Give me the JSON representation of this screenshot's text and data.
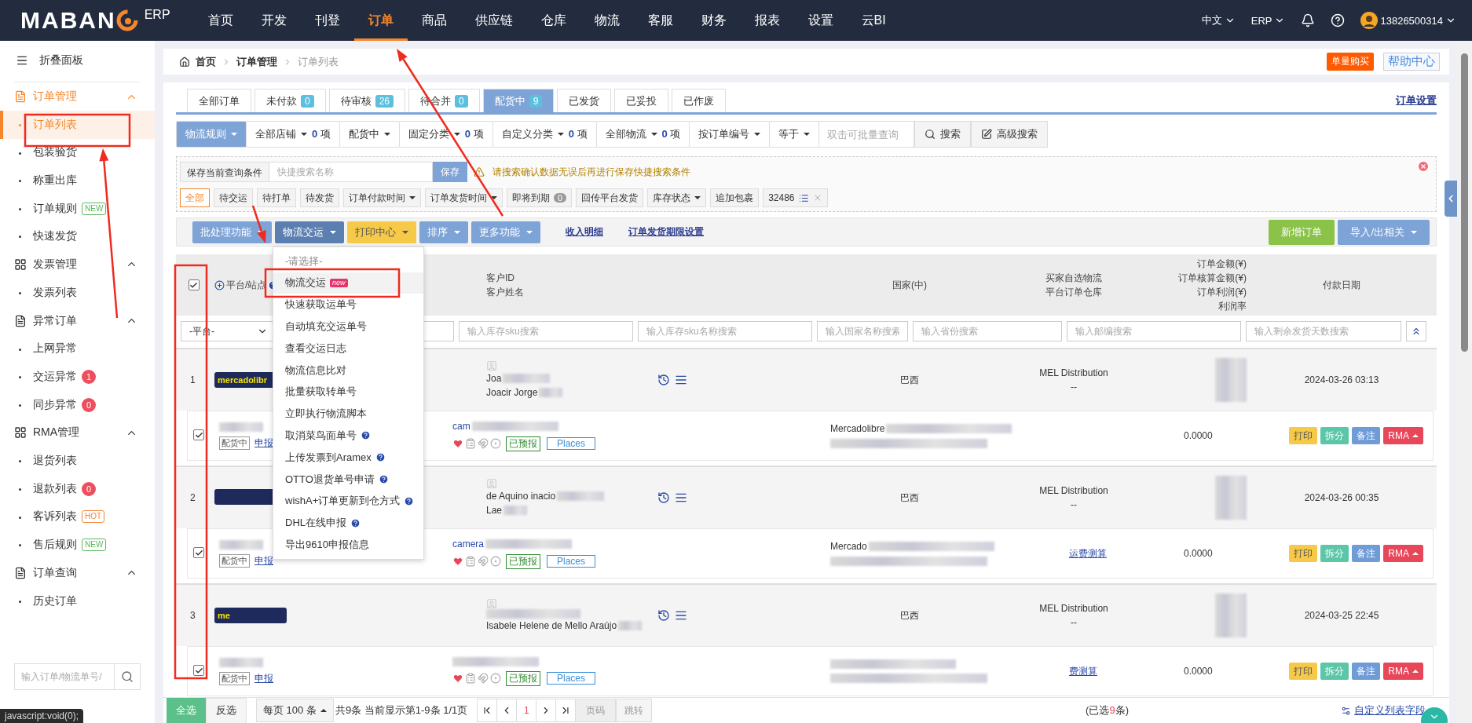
{
  "topbar": {
    "logo": "MABAN",
    "logo_suffix": "ERP",
    "nav": [
      {
        "label": "首页",
        "selected": false
      },
      {
        "label": "开发",
        "selected": false
      },
      {
        "label": "刊登",
        "selected": false
      },
      {
        "label": "订单",
        "selected": true
      },
      {
        "label": "商品",
        "selected": false
      },
      {
        "label": "供应链",
        "selected": false
      },
      {
        "label": "仓库",
        "selected": false
      },
      {
        "label": "物流",
        "selected": false
      },
      {
        "label": "客服",
        "selected": false
      },
      {
        "label": "财务",
        "selected": false
      },
      {
        "label": "报表",
        "selected": false
      },
      {
        "label": "设置",
        "selected": false
      },
      {
        "label": "云BI",
        "selected": false
      }
    ],
    "language": "中文",
    "system": "ERP",
    "user": "13826500314"
  },
  "sidebar": {
    "collapse": "折叠面板",
    "groups": [
      {
        "title": "订单管理",
        "kind": "doc",
        "active": true,
        "expanded": true,
        "items": [
          {
            "label": "订单列表",
            "selected": true
          },
          {
            "label": "包装验货",
            "selected": false
          },
          {
            "label": "称重出库",
            "selected": false
          },
          {
            "label": "订单规则",
            "selected": false,
            "badge": {
              "kind": "new",
              "text": "NEW"
            }
          },
          {
            "label": "快速发货",
            "selected": false
          }
        ]
      },
      {
        "title": "发票管理",
        "kind": "grid",
        "active": false,
        "expanded": true,
        "items": [
          {
            "label": "发票列表",
            "selected": false
          }
        ]
      },
      {
        "title": "异常订单",
        "kind": "doc",
        "active": false,
        "expanded": true,
        "items": [
          {
            "label": "上网异常",
            "selected": false
          },
          {
            "label": "交运异常",
            "selected": false,
            "badge": {
              "kind": "count",
              "text": "1"
            }
          },
          {
            "label": "同步异常",
            "selected": false,
            "badge": {
              "kind": "count",
              "text": "0"
            }
          }
        ]
      },
      {
        "title": "RMA管理",
        "kind": "grid",
        "active": false,
        "expanded": true,
        "items": [
          {
            "label": "退货列表",
            "selected": false
          },
          {
            "label": "退款列表",
            "selected": false,
            "badge": {
              "kind": "count",
              "text": "0"
            }
          },
          {
            "label": "客诉列表",
            "selected": false,
            "badge": {
              "kind": "hot",
              "text": "HOT"
            }
          },
          {
            "label": "售后规则",
            "selected": false,
            "badge": {
              "kind": "new",
              "text": "NEW"
            }
          }
        ]
      },
      {
        "title": "订单查询",
        "kind": "doc",
        "active": false,
        "expanded": true,
        "items": [
          {
            "label": "历史订单",
            "selected": false
          }
        ]
      }
    ],
    "search": {
      "placeholder": "输入订单/物流单号/"
    }
  },
  "breadcrumb": [
    "首页",
    "订单管理",
    "订单列表"
  ],
  "header_buttons": {
    "buy": "单量购买",
    "help": "帮助中心"
  },
  "tabs": [
    {
      "label": "全部订单",
      "selected": false
    },
    {
      "label": "未付款",
      "count": "0",
      "selected": false
    },
    {
      "label": "待审核",
      "count": "26",
      "selected": false
    },
    {
      "label": "待合并",
      "count": "0",
      "selected": false
    },
    {
      "label": "配货中",
      "count": "9",
      "selected": true
    },
    {
      "label": "已发货",
      "selected": false
    },
    {
      "label": "已妥投",
      "selected": false
    },
    {
      "label": "已作废",
      "selected": false
    }
  ],
  "settings_link": "订单设置",
  "filters": [
    {
      "kind": "primary",
      "label": "物流规则"
    },
    {
      "kind": "dropdown",
      "label": "全部店铺",
      "count": "**0** 项"
    },
    {
      "kind": "dropdown",
      "label": "配货中"
    },
    {
      "kind": "dropdown",
      "label": "固定分类",
      "count": "**0** 项"
    },
    {
      "kind": "dropdown",
      "label": "自定义分类",
      "count": "**0** 项"
    },
    {
      "kind": "dropdown",
      "label": "全部物流",
      "count": "**0** 项"
    },
    {
      "kind": "dropdown",
      "label": "按订单编号"
    },
    {
      "kind": "dropdown",
      "label": "等于"
    }
  ],
  "query": {
    "placeholder": "双击可批量查询",
    "search": "搜索",
    "advanced": "高级搜索"
  },
  "saved": {
    "label": "保存当前查询条件",
    "placeholder": "快捷搜索名称",
    "save": "保存",
    "warning": "请搜索确认数据无误后再进行保存快捷搜索条件",
    "chips": [
      {
        "kind": "plain",
        "label": "全部",
        "selected": true
      },
      {
        "kind": "plain",
        "label": "待交运",
        "selected": false
      },
      {
        "kind": "plain",
        "label": "待打单",
        "selected": false
      },
      {
        "kind": "plain",
        "label": "待发货",
        "selected": false
      },
      {
        "kind": "dropdown",
        "label": "订单付款时间",
        "selected": false
      },
      {
        "kind": "dropdown",
        "label": "订单发货时间",
        "selected": false
      },
      {
        "kind": "count",
        "label": "即将到期",
        "count": "0",
        "selected": false
      },
      {
        "kind": "plain",
        "label": "回传平台发货",
        "selected": false
      },
      {
        "kind": "dropdown",
        "label": "库存状态",
        "selected": false
      },
      {
        "kind": "plain",
        "label": "追加包裹",
        "selected": false
      },
      {
        "kind": "tag",
        "label": "32486",
        "selected": false
      }
    ]
  },
  "actions": {
    "buttons": [
      {
        "label": "批处理功能",
        "kind": "blue",
        "open": false
      },
      {
        "label": "物流交运",
        "kind": "blue",
        "open": true
      },
      {
        "label": "打印中心",
        "kind": "yellow",
        "open": false
      },
      {
        "label": "排序",
        "kind": "blue",
        "open": false
      },
      {
        "label": "更多功能",
        "kind": "blue",
        "open": false
      }
    ],
    "links": [
      "收入明细",
      "订单发货期限设置"
    ],
    "right": [
      {
        "label": "新增订单",
        "kind": "green",
        "caret": false
      },
      {
        "label": "导入/出相关",
        "kind": "blue",
        "caret": true
      }
    ]
  },
  "dropdown": {
    "placeholder": "-请选择-",
    "items": [
      {
        "label": "物流交运",
        "badge": "new",
        "help": false,
        "selected": true
      },
      {
        "label": "快速获取运单号",
        "help": false,
        "selected": false
      },
      {
        "label": "自动填充交运单号",
        "help": false,
        "selected": false
      },
      {
        "label": "查看交运日志",
        "help": false,
        "selected": false
      },
      {
        "label": "物流信息比对",
        "help": false,
        "selected": false
      },
      {
        "label": "批量获取转单号",
        "help": false,
        "selected": false
      },
      {
        "label": "立即执行物流脚本",
        "help": false,
        "selected": false
      },
      {
        "label": "取消菜鸟面单号",
        "help": true,
        "selected": false
      },
      {
        "label": "上传发票到Aramex",
        "help": true,
        "selected": false
      },
      {
        "label": "OTTO退货单号申请",
        "help": true,
        "selected": false
      },
      {
        "label": "wishA+订单更新到仓方式",
        "help": true,
        "selected": false
      },
      {
        "label": "DHL在线申报",
        "help": true,
        "selected": false
      },
      {
        "label": "导出9610申报信息",
        "help": false,
        "selected": false
      }
    ]
  },
  "table": {
    "all_checked": true,
    "platform": "平台/站点",
    "customer": [
      "客户ID",
      "客户姓名"
    ],
    "country": "国家(中)",
    "logistics": [
      "买家自选物流",
      "平台订单仓库"
    ],
    "amounts": [
      "订单金额(¥)",
      "订单核算金额(¥)",
      "订单利润(¥)",
      "利润率"
    ],
    "date": "付款日期",
    "platform_select": "-平台-",
    "search_placeholders": [
      "输入库存sku搜索",
      "输入库存sku名称搜索",
      "输入国家名称搜索",
      "输入省份搜索",
      "输入邮编搜索",
      "输入剩余发货天数搜索"
    ]
  },
  "orders": [
    {
      "index": "1",
      "platform": "mercadolibr",
      "customer_id": "Joa",
      "customer_name": "Joacir Jorge",
      "country": "巴西",
      "logistics": "MEL Distribution",
      "warehouse": "--",
      "date": "2024-03-26 03:13",
      "checked": true,
      "status": "配货中",
      "declare": "申报",
      "product": "cam",
      "forecast": "已预报",
      "places": "Places",
      "store": "Mercadolibre",
      "amount": "0.0000",
      "buttons": [
        {
          "kind": "print",
          "label": "打印"
        },
        {
          "kind": "split",
          "label": "拆分"
        },
        {
          "kind": "note",
          "label": "备注"
        },
        {
          "kind": "rma",
          "label": "RMA"
        }
      ]
    },
    {
      "index": "2",
      "customer_id": "de Aquino inacio",
      "customer_name": "Lae",
      "country": "巴西",
      "logistics": "MEL Distribution",
      "warehouse": "--",
      "date": "2024-03-26 00:35",
      "checked": true,
      "status": "配货中",
      "declare": "申报",
      "product": "camera",
      "forecast": "已预报",
      "places": "Places",
      "store": "Mercado",
      "freight": "运费测算",
      "amount": "0.0000",
      "buttons": [
        {
          "kind": "print",
          "label": "打印"
        },
        {
          "kind": "split",
          "label": "拆分"
        },
        {
          "kind": "note",
          "label": "备注"
        },
        {
          "kind": "rma",
          "label": "RMA"
        }
      ]
    },
    {
      "index": "3",
      "platform": "me",
      "customer_name": "Isabele Helene de Mello Araújo",
      "country": "巴西",
      "logistics": "MEL Distribution",
      "warehouse": "--",
      "date": "2024-03-25 22:45",
      "checked": true,
      "status": "配货中",
      "declare": "申报",
      "forecast": "已预报",
      "places": "Places",
      "freight": "费测算",
      "amount": "0.0000",
      "buttons": [
        {
          "kind": "print",
          "label": "打印"
        },
        {
          "kind": "split",
          "label": "拆分"
        },
        {
          "kind": "note",
          "label": "备注"
        },
        {
          "kind": "rma",
          "label": "RMA"
        }
      ]
    }
  ],
  "footer": {
    "select_all": "全选",
    "invert": "反选",
    "per_page": "每页 100 条",
    "summary": "共9条 当前显示第1-9条 1/1页",
    "page": "1",
    "page_placeholder": "页码",
    "jump": "跳转",
    "selected": "(已选**9**条)",
    "custom_fields": "自定义列表字段"
  },
  "status_text": "javascript:void(0);"
}
